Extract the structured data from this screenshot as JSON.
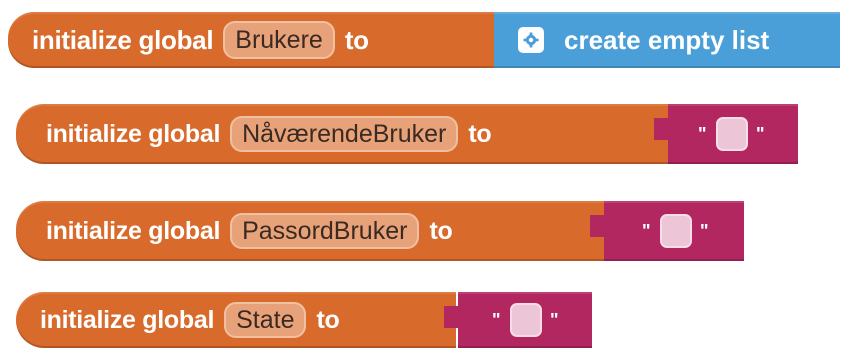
{
  "blocks": [
    {
      "keyword": "initialize global",
      "variable": "Brukere",
      "to_label": "to",
      "value": {
        "type": "list",
        "label": "create empty list",
        "icon": "gear-icon"
      }
    },
    {
      "keyword": "initialize global",
      "variable": "NåværendeBruker",
      "to_label": "to",
      "value": {
        "type": "text",
        "content": ""
      }
    },
    {
      "keyword": "initialize global",
      "variable": "PassordBruker",
      "to_label": "to",
      "value": {
        "type": "text",
        "content": ""
      }
    },
    {
      "keyword": "initialize global",
      "variable": "State",
      "to_label": "to",
      "value": {
        "type": "text",
        "content": ""
      }
    }
  ],
  "colors": {
    "variables_block": "#d86a2b",
    "list_block": "#4a9fd8",
    "text_block": "#b2275f"
  }
}
